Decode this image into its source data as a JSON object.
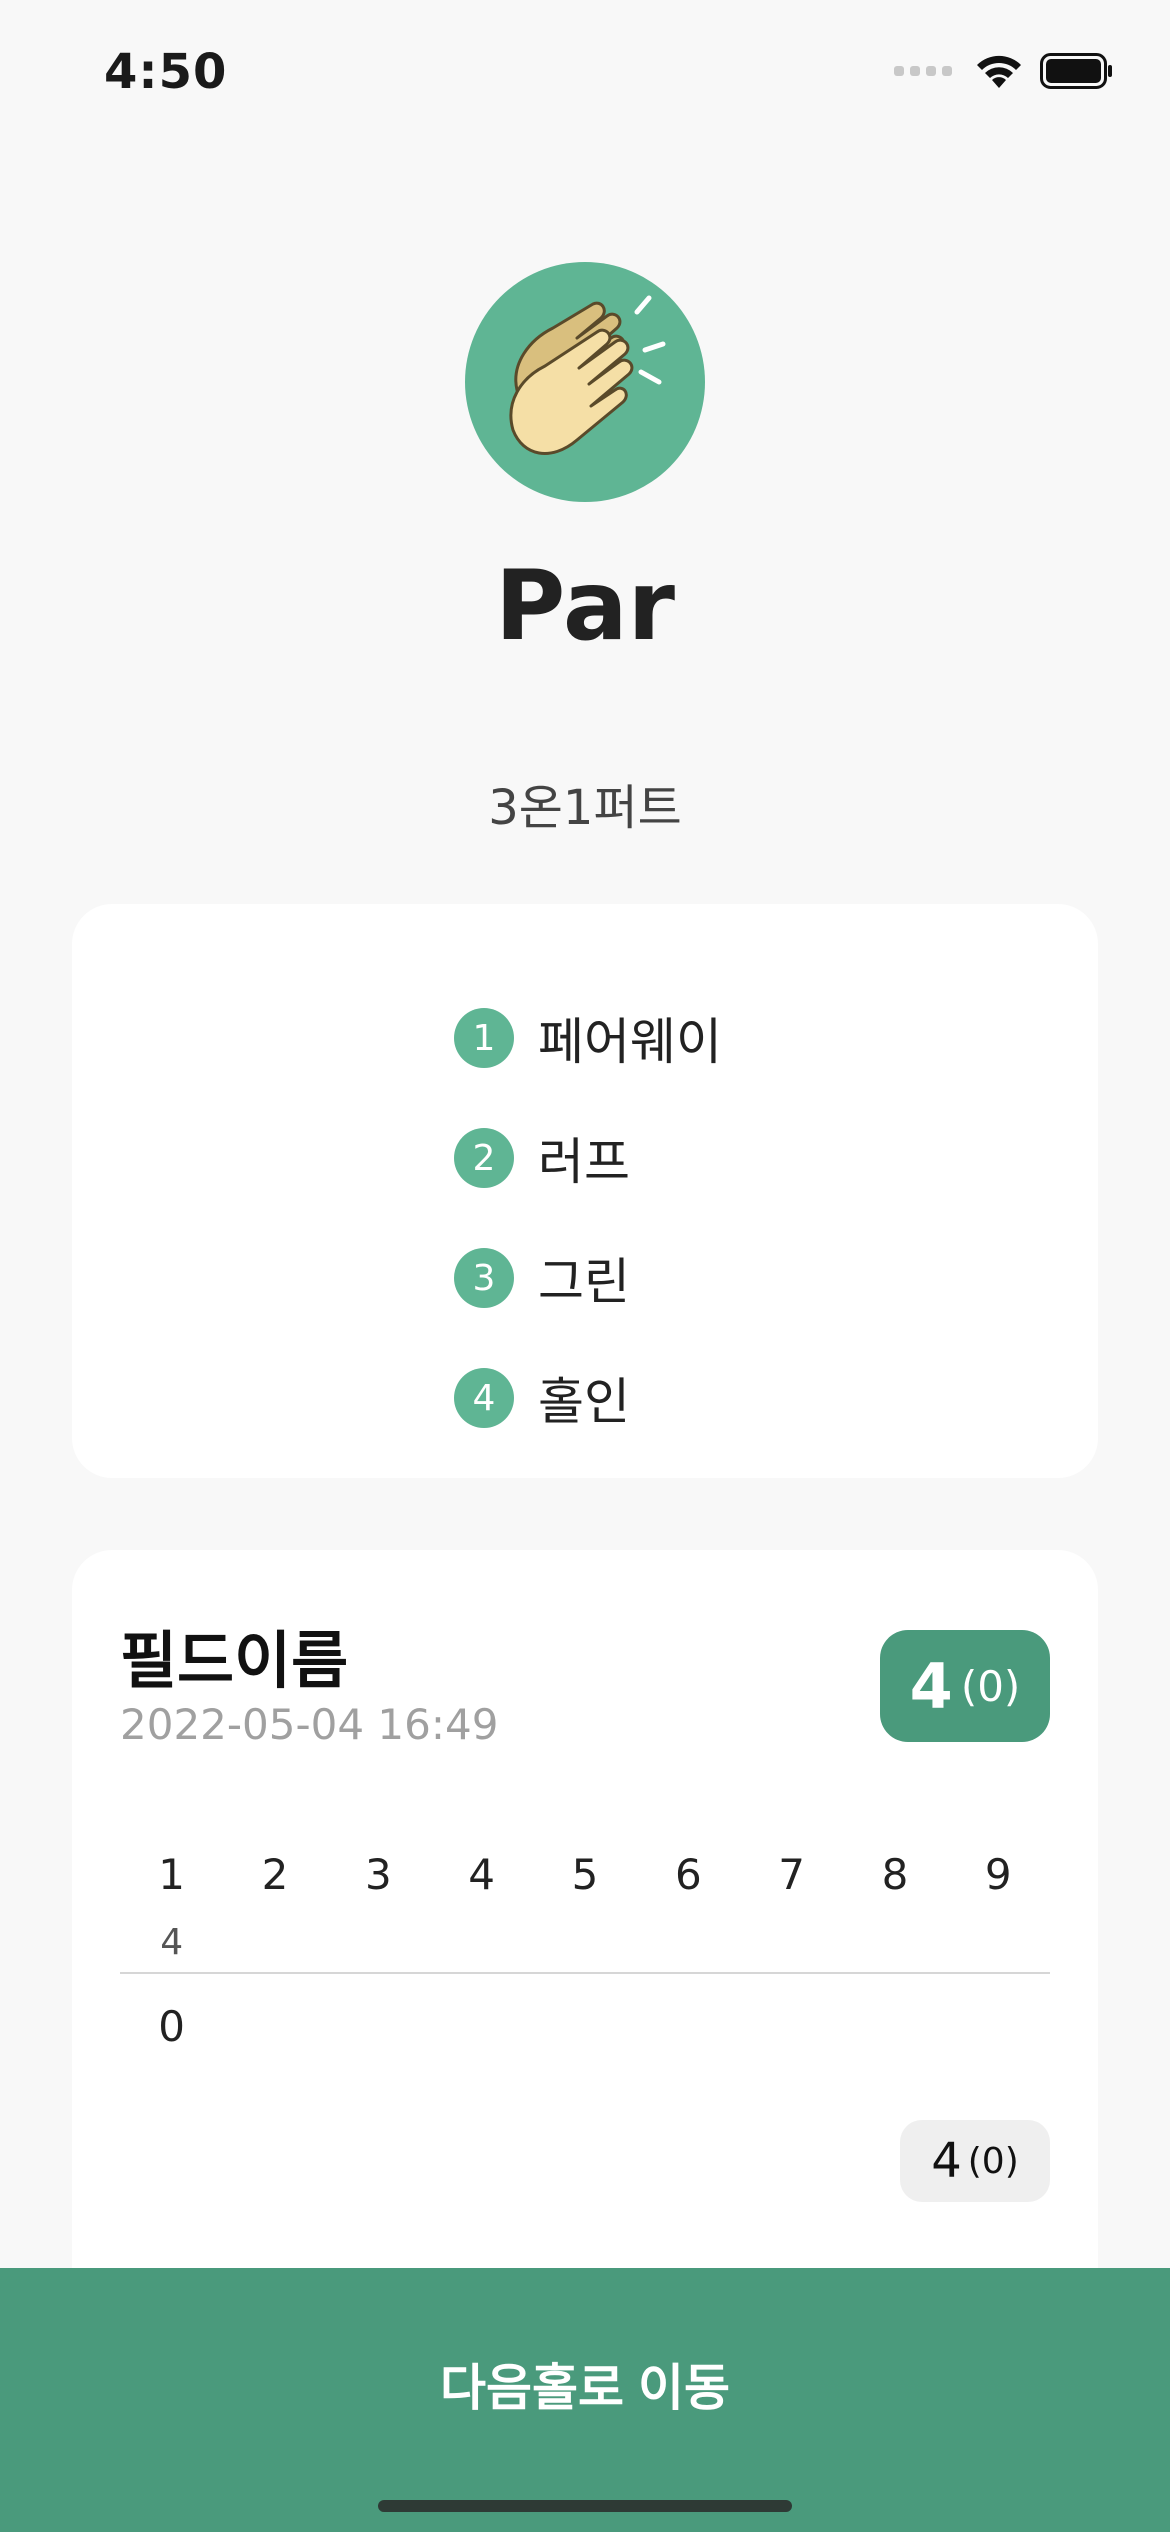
{
  "status_bar": {
    "time": "4:50"
  },
  "result": {
    "icon": "clapping-hands-icon",
    "title": "Par",
    "description": "3온1퍼트"
  },
  "shots": [
    {
      "num": "1",
      "label": "페어웨이"
    },
    {
      "num": "2",
      "label": "러프"
    },
    {
      "num": "3",
      "label": "그린"
    },
    {
      "num": "4",
      "label": "홀인"
    }
  ],
  "scorecard": {
    "field_name": "필드이름",
    "date": "2022-05-04 16:49",
    "total": {
      "strokes": "4",
      "diff": "(0)"
    },
    "holes": [
      "1",
      "2",
      "3",
      "4",
      "5",
      "6",
      "7",
      "8",
      "9"
    ],
    "pars": [
      "4",
      "",
      "",
      "",
      "",
      "",
      "",
      "",
      ""
    ],
    "scores": [
      "0",
      "",
      "",
      "",
      "",
      "",
      "",
      "",
      ""
    ],
    "subtotal": {
      "strokes": "4",
      "diff": "(0)"
    }
  },
  "next_button": {
    "label": "다음홀로 이동"
  },
  "colors": {
    "accent": "#5fb594",
    "accent_dark": "#4a9a7c",
    "background": "#f8f8f8"
  }
}
